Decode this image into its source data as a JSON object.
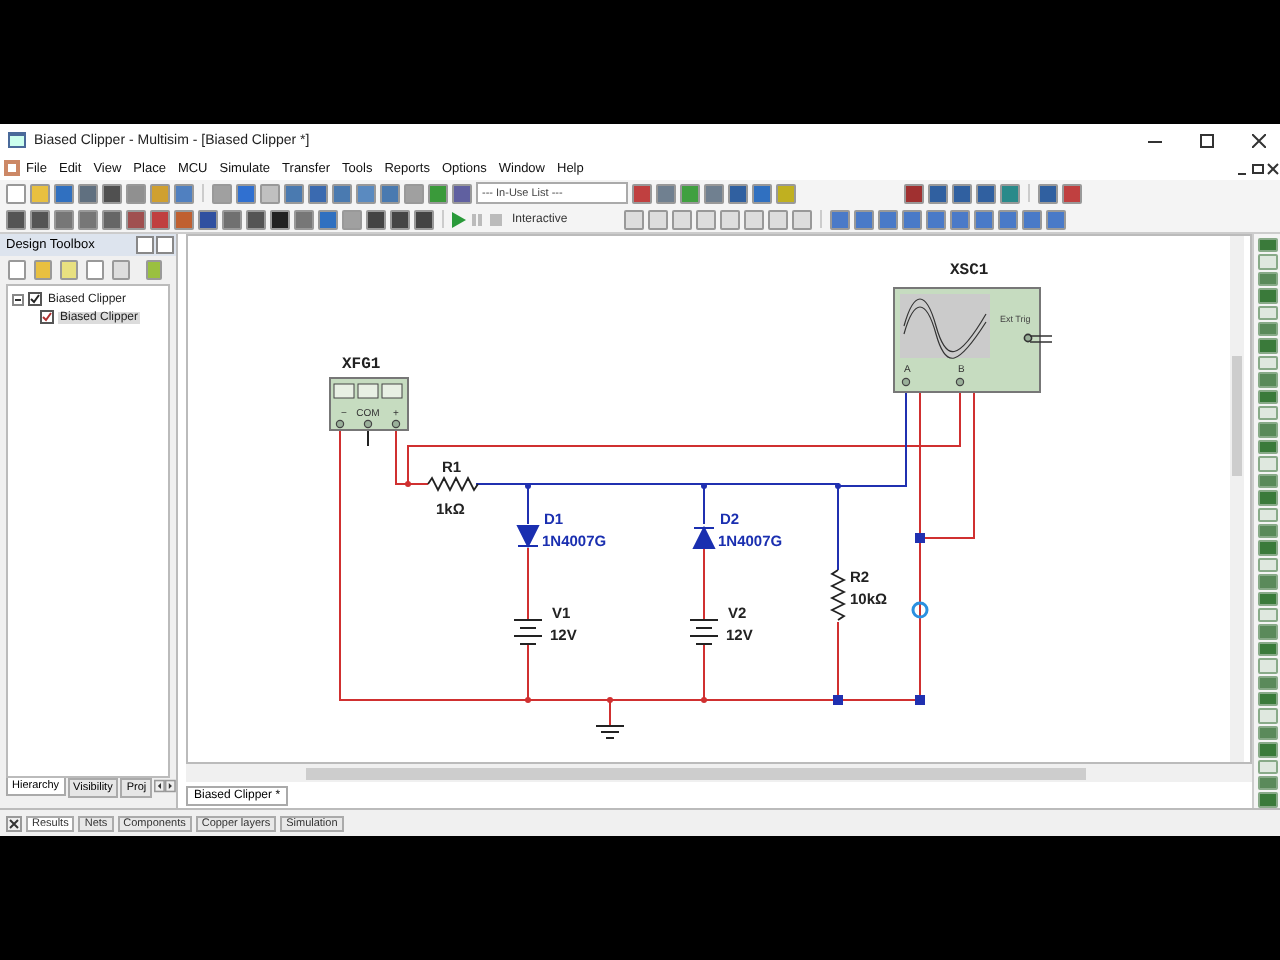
{
  "window": {
    "title": "Biased Clipper - Multisim - [Biased Clipper *]"
  },
  "menu": [
    "File",
    "Edit",
    "View",
    "Place",
    "MCU",
    "Simulate",
    "Transfer",
    "Tools",
    "Reports",
    "Options",
    "Window",
    "Help"
  ],
  "toolbar": {
    "in_use_list": "--- In-Use List ---",
    "interactive": "Interactive"
  },
  "design_toolbox": {
    "title": "Design Toolbox",
    "tree": [
      {
        "label": "Biased Clipper",
        "expanded": true,
        "selected": false,
        "children": [
          {
            "label": "Biased Clipper",
            "selected": true
          }
        ]
      }
    ],
    "tabs": [
      {
        "label": "Hierarchy",
        "selected": true
      },
      {
        "label": "Visibility",
        "selected": false
      },
      {
        "label": "Proj",
        "selected": false
      }
    ]
  },
  "schematic": {
    "generator": {
      "label": "XFG1",
      "terminals": [
        "−",
        "COM",
        "+"
      ]
    },
    "oscilloscope": {
      "label": "XSC1",
      "channels": [
        "A",
        "B"
      ],
      "trigger": "Ext Trig"
    },
    "parts": [
      {
        "kind": "resistor",
        "name": "R1",
        "value": "1kΩ"
      },
      {
        "kind": "diode",
        "name": "D1",
        "value": "1N4007G",
        "flipped": false
      },
      {
        "kind": "diode",
        "name": "D2",
        "value": "1N4007G",
        "flipped": true
      },
      {
        "kind": "battery",
        "name": "V1",
        "value": "12V"
      },
      {
        "kind": "battery",
        "name": "V2",
        "value": "12V"
      },
      {
        "kind": "resistor",
        "name": "R2",
        "value": "10kΩ"
      }
    ]
  },
  "sheet_tabs": [
    {
      "label": "Biased Clipper *",
      "selected": true
    }
  ],
  "results_tabs": [
    {
      "label": "Results",
      "selected": true
    },
    {
      "label": "Nets",
      "selected": false
    },
    {
      "label": "Components",
      "selected": false
    },
    {
      "label": "Copper layers",
      "selected": false
    },
    {
      "label": "Simulation",
      "selected": false
    }
  ]
}
